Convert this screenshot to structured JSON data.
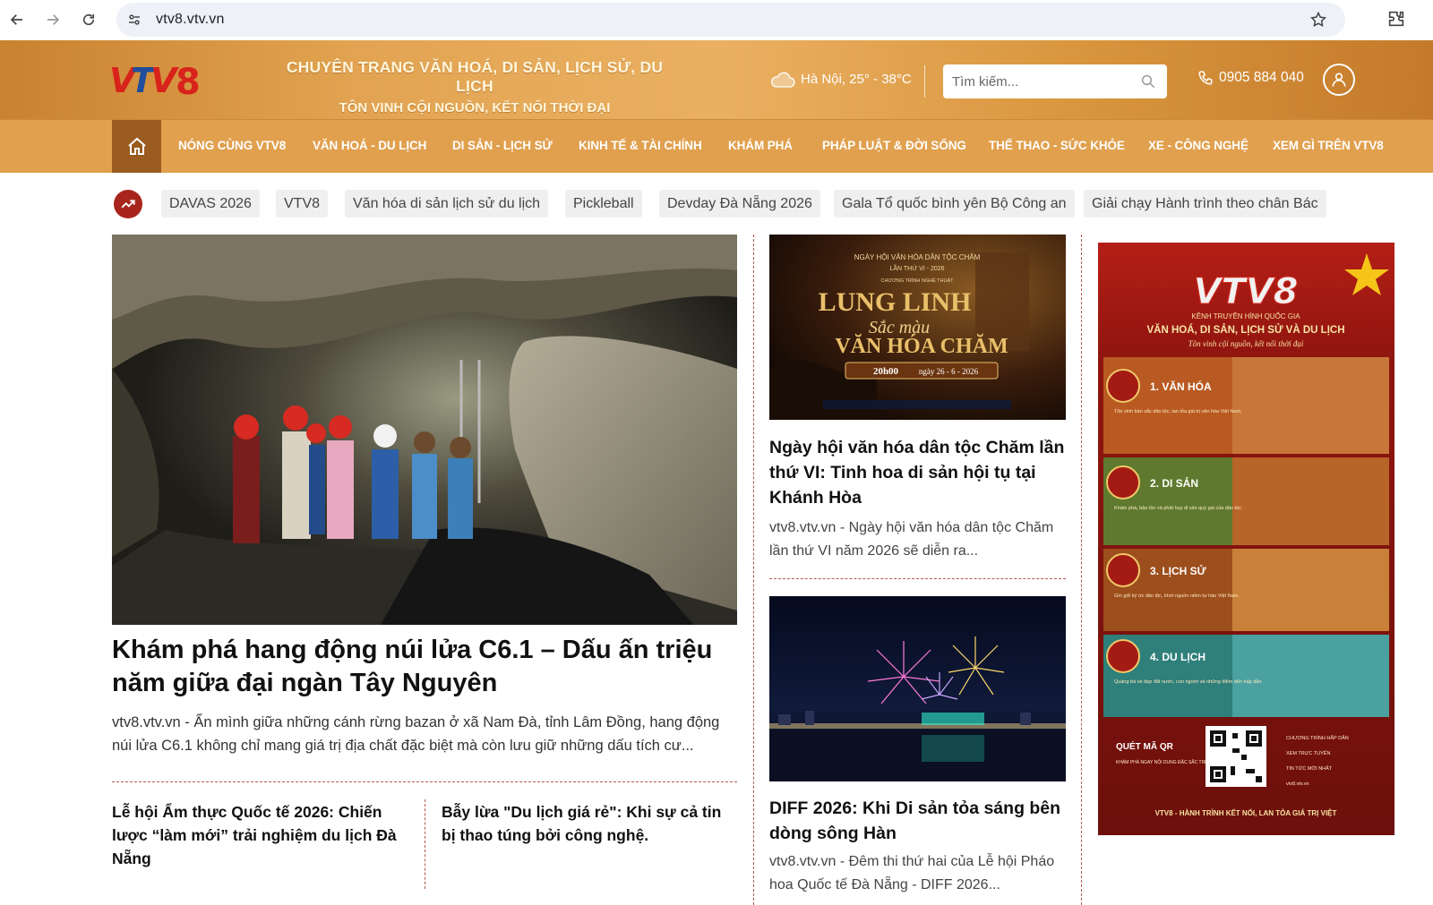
{
  "browser": {
    "url": "vtv8.vtv.vn"
  },
  "header": {
    "logo_text": "VTV8",
    "slogan_line1": "CHUYÊN TRANG VĂN HOÁ, DI SẢN, LỊCH SỬ, DU LỊCH",
    "slogan_line2": "TÔN VINH CỘI NGUỒN, KẾT NỐI THỜI ĐẠI",
    "weather": "Hà Nội, 25° - 38°C",
    "search_placeholder": "Tìm kiếm...",
    "phone": "0905 884 040"
  },
  "nav": {
    "items": [
      "NÓNG CÙNG VTV8",
      "VĂN HOÁ - DU LỊCH",
      "DI SẢN - LỊCH SỬ",
      "KINH TẾ & TÀI CHÍNH",
      "KHÁM PHÁ",
      "PHÁP LUẬT & ĐỜI SỐNG",
      "THỂ THAO - SỨC KHỎE",
      "XE - CÔNG NGHỆ",
      "XEM GÌ TRÊN VTV8"
    ]
  },
  "trending": {
    "tags": [
      "DAVAS 2026",
      "VTV8",
      "Văn hóa di sản lịch sử du lịch",
      "Pickleball",
      "Devday Đà Nẵng 2026",
      "Gala Tổ quốc bình yên Bộ Công an",
      "Giải chạy Hành trình theo chân Bác"
    ]
  },
  "featured": {
    "title": "Khám phá hang động núi lửa C6.1 – Dấu ấn triệu năm giữa đại ngàn Tây Nguyên",
    "description": "vtv8.vtv.vn - Ẩn mình giữa những cánh rừng bazan ở xã Nam Đà, tỉnh Lâm Đồng, hang động núi lửa C6.1 không chỉ mang giá trị địa chất đặc biệt mà còn lưu giữ những dấu tích cư..."
  },
  "sub_articles": [
    {
      "title": "Lễ hội Ẩm thực Quốc tế 2026: Chiến lược “làm mới” trải nghiệm du lịch Đà Nẵng"
    },
    {
      "title": "Bẫy lừa \"Du lịch giá rẻ\": Khi sự cả tin bị thao túng bởi công nghệ."
    }
  ],
  "middle": {
    "articles": [
      {
        "title": "Ngày hội văn hóa dân tộc Chăm lần thứ VI: Tinh hoa di sản hội tụ tại Khánh Hòa",
        "description": "vtv8.vtv.vn - Ngày hội văn hóa dân tộc Chăm lần thứ VI năm 2026 sẽ diễn ra...",
        "image": {
          "line1": "NGÀY HỘI VĂN HÓA DÂN TỘC CHĂM",
          "line2": "LẦN THỨ VI - 2026",
          "line3": "CHƯƠNG TRÌNH NGHỆ THUẬT",
          "headline1": "LUNG LINH",
          "headline2": "Sắc màu",
          "headline3": "VĂN HÓA CHĂM",
          "time": "20h00",
          "date": "ngày 26 - 6 - 2026"
        }
      },
      {
        "title": "DIFF 2026: Khi Di sản tỏa sáng bên dòng sông Hàn",
        "description": "vtv8.vtv.vn - Đêm thi thứ hai của Lễ hội Pháo hoa Quốc tế Đà Nẵng - DIFF 2026..."
      }
    ]
  },
  "ad": {
    "logo": "VTV8",
    "subtitle": "KÊNH TRUYỀN HÌNH QUỐC GIA",
    "title": "VĂN HOÁ, DI SẢN, LỊCH SỬ VÀ DU LỊCH",
    "tagline": "Tôn vinh cội nguồn, kết nối thời đại",
    "sections": [
      {
        "label": "1. VĂN HÓA",
        "text": "Tôn vinh bản sắc dân tộc, lan tỏa giá trị văn hóa Việt Nam."
      },
      {
        "label": "2. DI SẢN",
        "text": "Khám phá, bảo tồn và phát huy di sản quý giá của dân tộc."
      },
      {
        "label": "3. LỊCH SỬ",
        "text": "Gìn giữ ký ức dân tộc, khơi nguồn niềm tự hào Việt Nam."
      },
      {
        "label": "4. DU LỊCH",
        "text": "Quảng bá vẻ đẹp đất nước, con người và những điểm đến hấp dẫn."
      }
    ],
    "qr_label": "QUÉT MÃ QR",
    "qr_sub": "KHÁM PHÁ NGAY NỘI DUNG ĐẶC SẮC TRÊN WEBSITE VTV8",
    "links": [
      "CHƯƠNG TRÌNH HẤP DẪN",
      "XEM TRỰC TUYẾN",
      "TIN TỨC MỚI NHẤT",
      "vtv8.vtv.vn"
    ],
    "footer": "VTV8 - HÀNH TRÌNH KẾT NỐI, LAN TỎA GIÁ TRỊ VIỆT"
  },
  "colors": {
    "nav_bg": "#e1a04e",
    "home_bg": "#9a5b1f",
    "accent_red": "#a8251d"
  }
}
